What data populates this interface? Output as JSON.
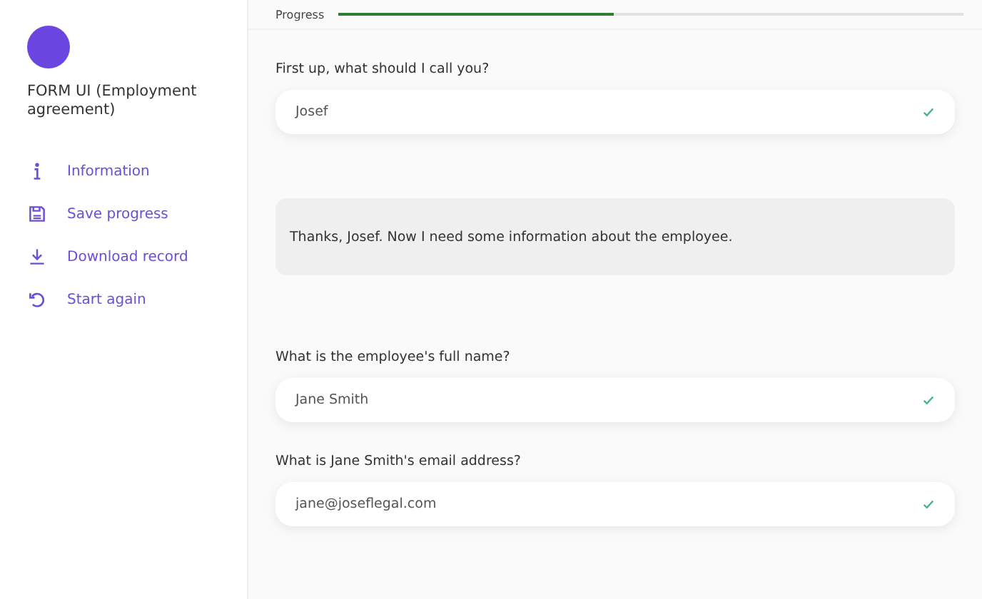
{
  "sidebar": {
    "title": "FORM UI (Employment agreement)",
    "items": [
      {
        "label": "Information"
      },
      {
        "label": "Save progress"
      },
      {
        "label": "Download record"
      },
      {
        "label": "Start again"
      }
    ]
  },
  "progress": {
    "label": "Progress",
    "level": 0.44
  },
  "conversation": [
    {
      "kind": "question",
      "text": "First up, what should I call you?"
    },
    {
      "kind": "answer",
      "value": "Josef",
      "valid": true
    },
    {
      "kind": "message",
      "text": "Thanks, Josef. Now I need some information about the employee."
    },
    {
      "kind": "question",
      "text": "What is the employee's full name?"
    },
    {
      "kind": "answer",
      "value": "Jane Smith",
      "valid": true
    },
    {
      "kind": "question",
      "text": "What is Jane Smith's email address?"
    },
    {
      "kind": "answer",
      "value": "jane@joseflegal.com",
      "valid": true
    }
  ]
}
